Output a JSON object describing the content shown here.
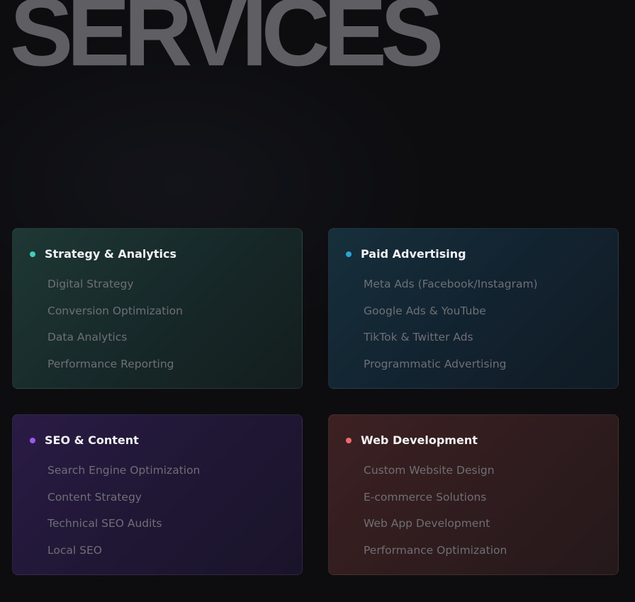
{
  "page": {
    "title": "SERVICES"
  },
  "services": [
    {
      "title": "Strategy & Analytics",
      "dot_color": "#3fd0bb",
      "items": [
        "Digital Strategy",
        "Conversion Optimization",
        "Data Analytics",
        "Performance Reporting"
      ]
    },
    {
      "title": "Paid Advertising",
      "dot_color": "#2aa3d6",
      "items": [
        "Meta Ads (Facebook/Instagram)",
        "Google Ads & YouTube",
        "TikTok & Twitter Ads",
        "Programmatic Advertising"
      ]
    },
    {
      "title": "SEO & Content",
      "dot_color": "#9b59f0",
      "items": [
        "Search Engine Optimization",
        "Content Strategy",
        "Technical SEO Audits",
        "Local SEO"
      ]
    },
    {
      "title": "Web Development",
      "dot_color": "#f06a6a",
      "items": [
        "Custom Website Design",
        "E-commerce Solutions",
        "Web App Development",
        "Performance Optimization"
      ]
    }
  ]
}
